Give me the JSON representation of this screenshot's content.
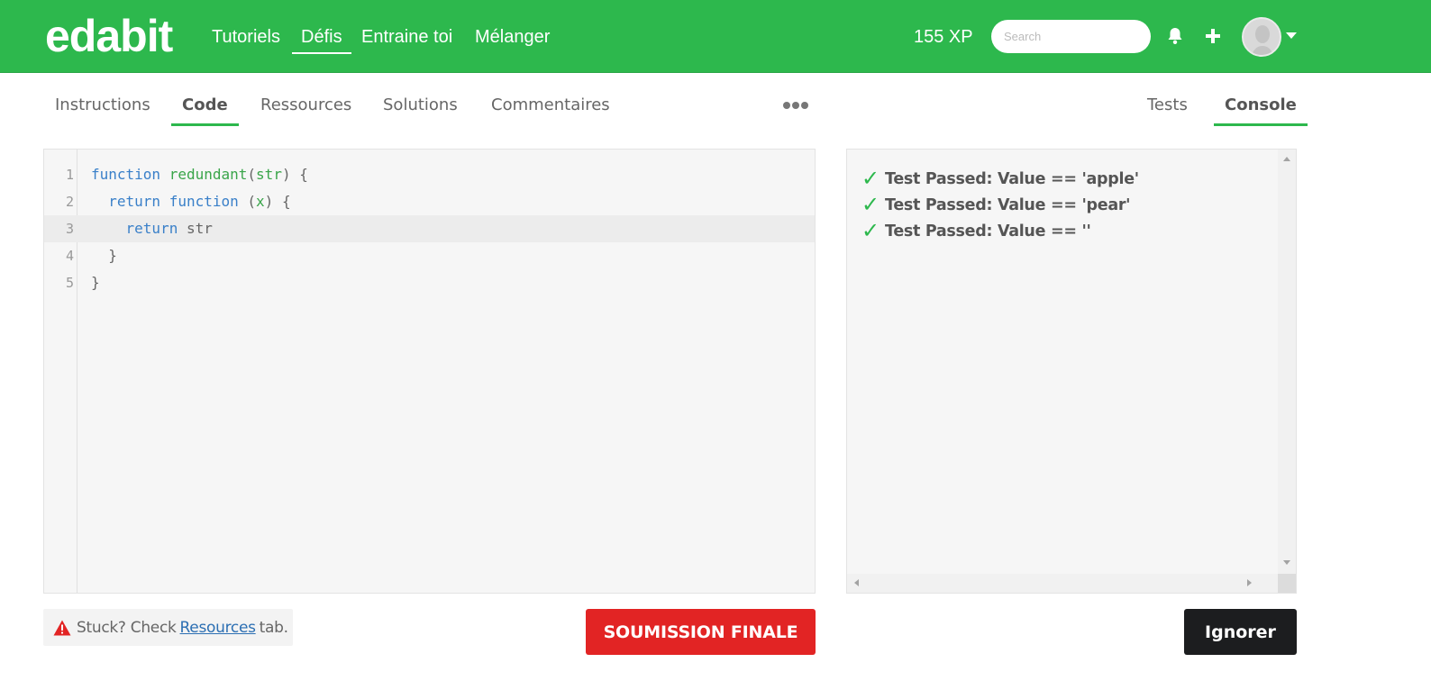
{
  "header": {
    "logo": "edabit",
    "nav": [
      "Tutoriels",
      "Défis",
      "Entraine toi",
      "Mélanger"
    ],
    "active_nav": "Défis",
    "xp": "155 XP",
    "search_placeholder": "Search",
    "icons": [
      "bell-icon",
      "plus-icon",
      "avatar",
      "caret-down-icon"
    ]
  },
  "tabs": {
    "left": [
      "Instructions",
      "Code",
      "Ressources",
      "Solutions",
      "Commentaires"
    ],
    "left_active": "Code",
    "right": [
      "Tests",
      "Console"
    ],
    "right_active": "Console"
  },
  "editor": {
    "line_numbers": [
      "1",
      "2",
      "3",
      "4",
      "5"
    ],
    "current_line": 3,
    "lines": [
      {
        "tokens": [
          {
            "t": "function",
            "c": "kw"
          },
          {
            "t": " ",
            "c": ""
          },
          {
            "t": "redundant",
            "c": "fn"
          },
          {
            "t": "(",
            "c": ""
          },
          {
            "t": "str",
            "c": "pm"
          },
          {
            "t": ") {",
            "c": ""
          }
        ]
      },
      {
        "tokens": [
          {
            "t": "  ",
            "c": ""
          },
          {
            "t": "return",
            "c": "kw"
          },
          {
            "t": " ",
            "c": ""
          },
          {
            "t": "function",
            "c": "kw"
          },
          {
            "t": " (",
            "c": ""
          },
          {
            "t": "x",
            "c": "pm"
          },
          {
            "t": ") {",
            "c": ""
          }
        ]
      },
      {
        "tokens": [
          {
            "t": "    ",
            "c": ""
          },
          {
            "t": "return",
            "c": "kw"
          },
          {
            "t": " str",
            "c": ""
          }
        ]
      },
      {
        "tokens": [
          {
            "t": "  }",
            "c": ""
          }
        ]
      },
      {
        "tokens": [
          {
            "t": "}",
            "c": ""
          }
        ]
      }
    ]
  },
  "console": {
    "results": [
      "Test Passed: Value == 'apple'",
      "Test Passed: Value == 'pear'",
      "Test Passed: Value == ''"
    ],
    "check_glyph": "✓"
  },
  "hint": {
    "prefix": "Stuck? Check",
    "link": "Resources",
    "suffix": "tab."
  },
  "buttons": {
    "submit": "SOUMISSION FINALE",
    "ignore": "Ignorer"
  },
  "colors": {
    "brand_green": "#2db84d",
    "submit_red": "#e22424",
    "ignore_black": "#1c1d1f",
    "keyword_blue": "#3a80c9",
    "link_blue": "#2c6fb3"
  }
}
